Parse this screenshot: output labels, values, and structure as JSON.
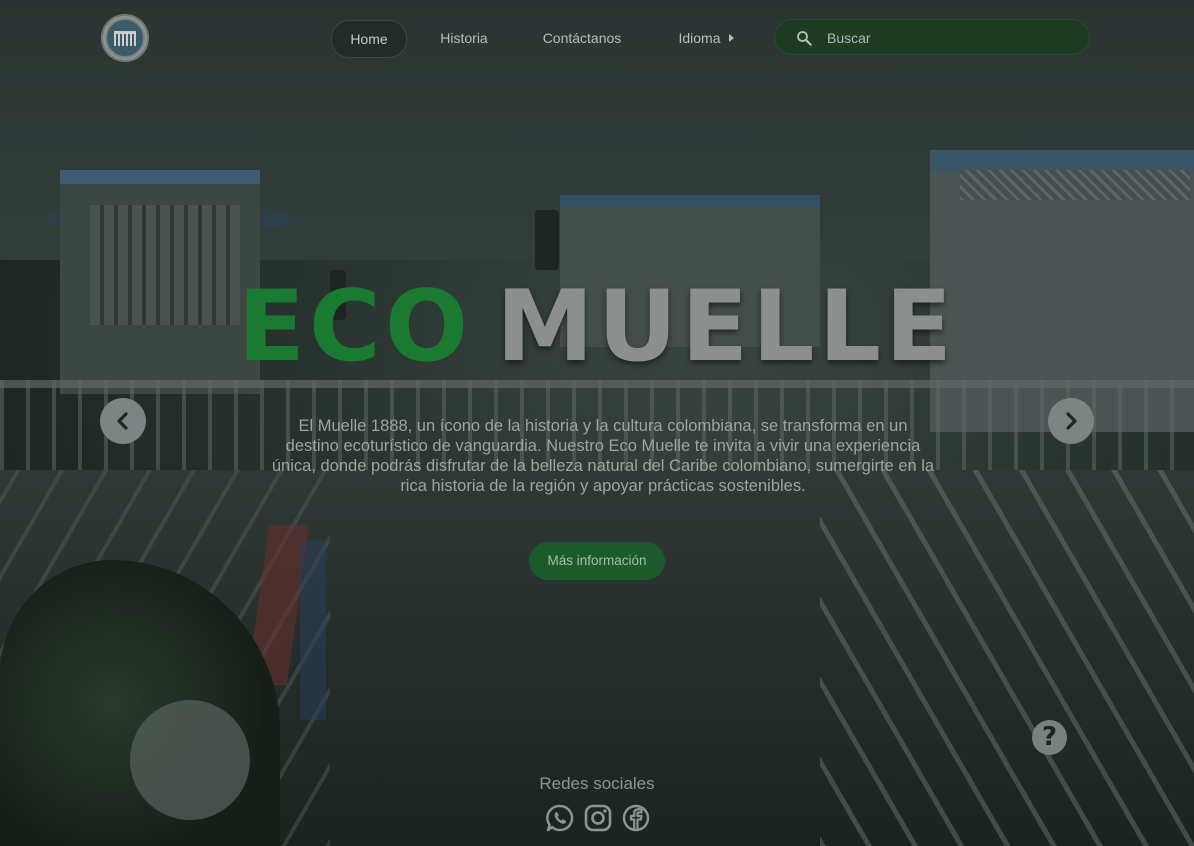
{
  "nav": {
    "items": [
      {
        "label": "Home",
        "active": true
      },
      {
        "label": "Historia"
      },
      {
        "label": "Contáctanos"
      },
      {
        "label": "Idioma"
      }
    ],
    "search": {
      "placeholder": "Buscar"
    }
  },
  "hero": {
    "title_part1": "ECO",
    "title_part2": "MUELLE",
    "description": "El Muelle 1888, un ícono de la historia y la cultura colombiana, se transforma en un destino ecoturístico de vanguardia. Nuestro Eco Muelle te invita a vivir una experiencia única, donde podrás disfrutar de la belleza natural del Caribe colombiano, sumergirte en la rica historia de la región y apoyar prácticas sostenibles.",
    "cta_label": "Más información"
  },
  "help": {
    "label": "?"
  },
  "social": {
    "title": "Redes sociales",
    "icons": [
      "whatsapp-icon",
      "instagram-icon",
      "facebook-icon"
    ]
  },
  "colors": {
    "eco_green": "#1a7a32",
    "muelle_gray": "#8b8f8e",
    "cta_bg": "#1d5a2b",
    "search_bg": "#1d3a22"
  }
}
